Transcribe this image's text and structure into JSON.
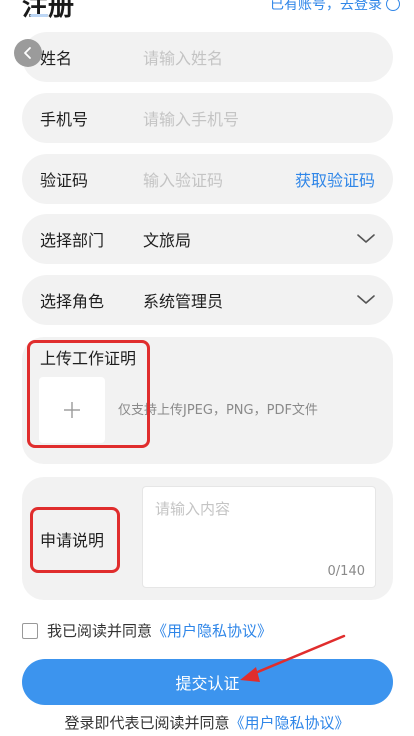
{
  "header": {
    "title": "注册",
    "login_text": "已有账号，去登录"
  },
  "form": {
    "name": {
      "label": "姓名",
      "placeholder": "请输入姓名"
    },
    "phone": {
      "label": "手机号",
      "placeholder": "请输入手机号"
    },
    "code": {
      "label": "验证码",
      "placeholder": "输入验证码",
      "action": "获取验证码"
    },
    "department": {
      "label": "选择部门",
      "value": "文旅局"
    },
    "role": {
      "label": "选择角色",
      "value": "系统管理员"
    },
    "upload": {
      "title": "上传工作证明",
      "hint": "仅支持上传JPEG，PNG，PDF文件",
      "plus": "+"
    },
    "description": {
      "label": "申请说明",
      "placeholder": "请输入内容",
      "counter": "0/140"
    }
  },
  "agreement": {
    "text": "我已阅读并同意",
    "link": "《用户隐私协议》",
    "checked": false
  },
  "submit_label": "提交认证",
  "footer": {
    "text": "登录即代表已阅读并同意",
    "link": "《用户隐私协议》"
  },
  "colors": {
    "accent": "#2f86e8",
    "button": "#3c94ee",
    "annotation": "#e02d2d",
    "field_bg": "#f2f2f2"
  },
  "icons": [
    "back-arrow-icon",
    "chevron-down-icon",
    "plus-icon",
    "login-circle-icon"
  ]
}
